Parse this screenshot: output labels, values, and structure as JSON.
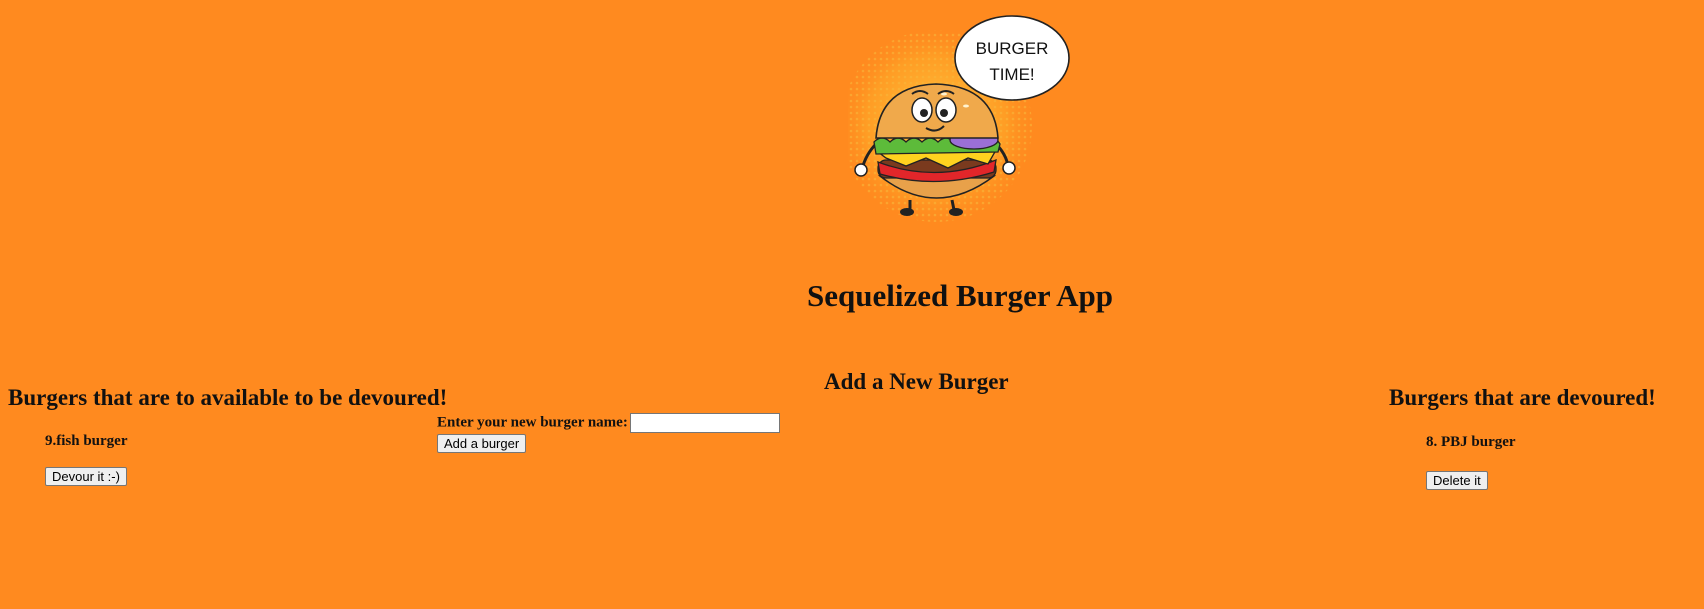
{
  "logo": {
    "speech_text": "BURGER TIME!",
    "line1": "BURGER",
    "line2": "TIME!"
  },
  "header": {
    "title": "Sequelized Burger App"
  },
  "available": {
    "heading": "Burgers that are to available to be devoured!",
    "items": [
      {
        "label": "9.fish burger",
        "button_label": "Devour it :-)"
      }
    ]
  },
  "form": {
    "heading": "Add a New Burger",
    "label": "Enter your new burger name:",
    "input_value": "",
    "input_placeholder": "",
    "submit_label": "Add a burger"
  },
  "devoured": {
    "heading": "Burgers that are devoured!",
    "items": [
      {
        "label": "8. PBJ burger",
        "button_label": "Delete it"
      }
    ]
  },
  "colors": {
    "background": "#FF8A1F",
    "text": "#111111"
  }
}
